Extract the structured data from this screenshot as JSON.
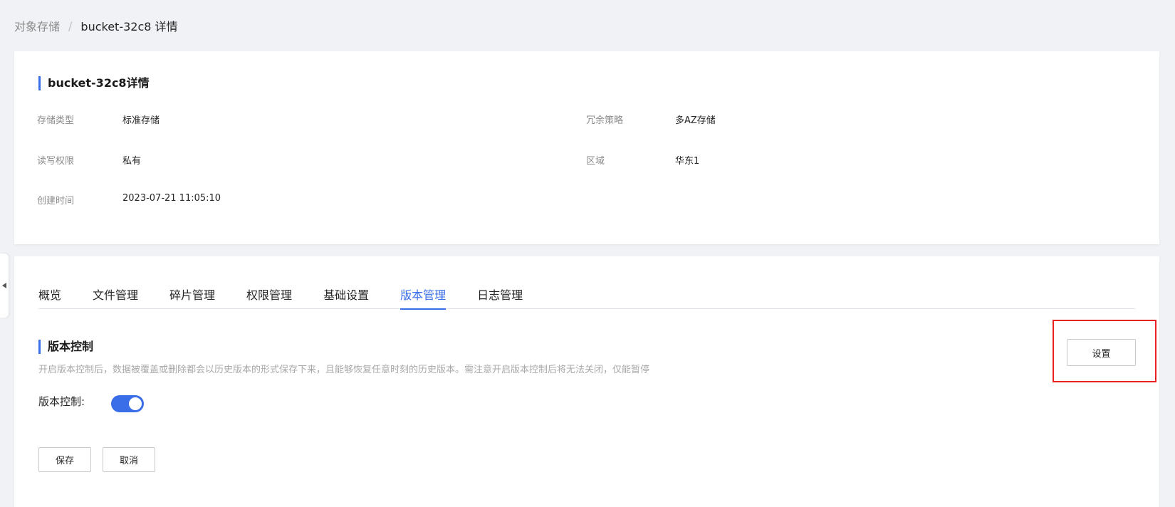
{
  "breadcrumb": {
    "parent": "对象存储",
    "separator": "/",
    "current": "bucket-32c8 详情"
  },
  "info": {
    "title": "bucket-32c8详情",
    "fields": [
      {
        "label": "存储类型",
        "value": "标准存储"
      },
      {
        "label": "冗余策略",
        "value": "多AZ存储"
      },
      {
        "label": "读写权限",
        "value": "私有"
      },
      {
        "label": "区域",
        "value": "华东1"
      },
      {
        "label": "创建时间",
        "value": "2023-07-21 11:05:10"
      }
    ]
  },
  "tabs": [
    {
      "label": "概览"
    },
    {
      "label": "文件管理"
    },
    {
      "label": "碎片管理"
    },
    {
      "label": "权限管理"
    },
    {
      "label": "基础设置"
    },
    {
      "label": "版本管理",
      "active": true
    },
    {
      "label": "日志管理"
    }
  ],
  "version_control": {
    "title": "版本控制",
    "description": "开启版本控制后，数据被覆盖或删除都会以历史版本的形式保存下来，且能够恢复任意时刻的历史版本。需注意开启版本控制后将无法关闭，仅能暂停",
    "toggle_label": "版本控制:",
    "enabled": true,
    "settings_label": "设置",
    "save_label": "保存",
    "cancel_label": "取消"
  },
  "colors": {
    "accent": "#3a6ee8",
    "highlight": "#e8231f"
  },
  "icons": {
    "side_handle": "caret-left-icon"
  }
}
